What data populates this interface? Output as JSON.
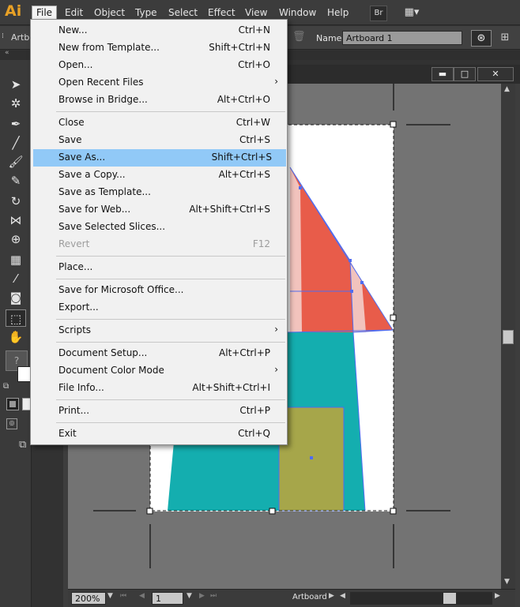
{
  "app": {
    "logo": "Ai"
  },
  "menubar": {
    "items": [
      "File",
      "Edit",
      "Object",
      "Type",
      "Select",
      "Effect",
      "View",
      "Window",
      "Help"
    ],
    "bridge_label": "Br"
  },
  "control_bar": {
    "left_label": "Artbo",
    "name_label": "Name:",
    "name_value": "Artboard 1"
  },
  "file_menu": {
    "items": [
      {
        "label": "New...",
        "shortcut": "Ctrl+N"
      },
      {
        "label": "New from Template...",
        "shortcut": "Shift+Ctrl+N"
      },
      {
        "label": "Open...",
        "shortcut": "Ctrl+O"
      },
      {
        "label": "Open Recent Files",
        "shortcut": "",
        "submenu": true
      },
      {
        "label": "Browse in Bridge...",
        "shortcut": "Alt+Ctrl+O"
      },
      {
        "label": "Close",
        "shortcut": "Ctrl+W"
      },
      {
        "label": "Save",
        "shortcut": "Ctrl+S"
      },
      {
        "label": "Save As...",
        "shortcut": "Shift+Ctrl+S",
        "highlighted": true
      },
      {
        "label": "Save a Copy...",
        "shortcut": "Alt+Ctrl+S"
      },
      {
        "label": "Save as Template...",
        "shortcut": ""
      },
      {
        "label": "Save for Web...",
        "shortcut": "Alt+Shift+Ctrl+S"
      },
      {
        "label": "Save Selected Slices...",
        "shortcut": ""
      },
      {
        "label": "Revert",
        "shortcut": "F12",
        "disabled": true
      },
      {
        "label": "Place...",
        "shortcut": ""
      },
      {
        "label": "Save for Microsoft Office...",
        "shortcut": ""
      },
      {
        "label": "Export...",
        "shortcut": ""
      },
      {
        "label": "Scripts",
        "shortcut": "",
        "submenu": true
      },
      {
        "label": "Document Setup...",
        "shortcut": "Alt+Ctrl+P"
      },
      {
        "label": "Document Color Mode",
        "shortcut": "",
        "submenu": true
      },
      {
        "label": "File Info...",
        "shortcut": "Alt+Shift+Ctrl+I"
      },
      {
        "label": "Print...",
        "shortcut": "Ctrl+P"
      },
      {
        "label": "Exit",
        "shortcut": "Ctrl+Q"
      }
    ],
    "highlight_color": "#91c9f7"
  },
  "statusbar": {
    "zoom": "200%",
    "artboard_number": "1",
    "status_text": "Artboard"
  },
  "artwork_colors": {
    "red": "#e85c4a",
    "pink": "#f2c3bd",
    "teal": "#14aeaf",
    "olive": "#a6a64a",
    "selection": "#4f6cf0"
  }
}
